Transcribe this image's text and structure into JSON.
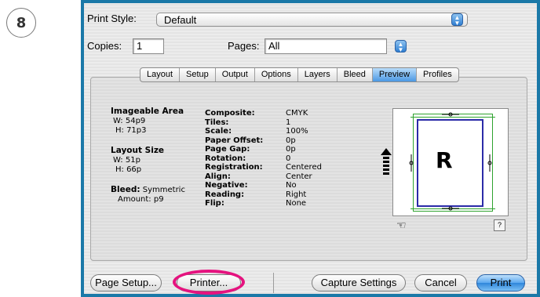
{
  "step": {
    "number": "8"
  },
  "print_style": {
    "label": "Print Style:",
    "value": "Default"
  },
  "copies": {
    "label": "Copies:",
    "value": "1"
  },
  "pages": {
    "label": "Pages:",
    "value": "All"
  },
  "tabs": [
    {
      "label": "Layout",
      "selected": false
    },
    {
      "label": "Setup",
      "selected": false
    },
    {
      "label": "Output",
      "selected": false
    },
    {
      "label": "Options",
      "selected": false
    },
    {
      "label": "Layers",
      "selected": false
    },
    {
      "label": "Bleed",
      "selected": false
    },
    {
      "label": "Preview",
      "selected": true
    },
    {
      "label": "Profiles",
      "selected": false
    }
  ],
  "imageable_area": {
    "title": "Imageable Area",
    "w": "W: 54p9",
    "h": "H: 71p3"
  },
  "layout_size": {
    "title": "Layout Size",
    "w": "W: 51p",
    "h": "H: 66p"
  },
  "bleed": {
    "title": "Bleed:",
    "value": "Symmetric",
    "amount": "Amount: p9"
  },
  "settings": [
    {
      "key": "Composite:",
      "value": "CMYK"
    },
    {
      "key": "Tiles:",
      "value": "1"
    },
    {
      "key": "Scale:",
      "value": "100%"
    },
    {
      "key": "Paper Offset:",
      "value": "0p"
    },
    {
      "key": "Page Gap:",
      "value": "0p"
    },
    {
      "key": "Rotation:",
      "value": "0"
    },
    {
      "key": "Registration:",
      "value": "Centered"
    },
    {
      "key": "Align:",
      "value": "Center"
    },
    {
      "key": "Negative:",
      "value": "No"
    },
    {
      "key": "Reading:",
      "value": "Right"
    },
    {
      "key": "Flip:",
      "value": "None"
    }
  ],
  "preview": {
    "glyph": "R",
    "help": "?"
  },
  "buttons": {
    "page_setup": "Page Setup...",
    "printer": "Printer...",
    "capture_settings": "Capture Settings",
    "cancel": "Cancel",
    "print": "Print"
  },
  "colors": {
    "frame": "#1b79a8",
    "highlight": "#e5137f",
    "accent_blue": "#2f86db"
  }
}
